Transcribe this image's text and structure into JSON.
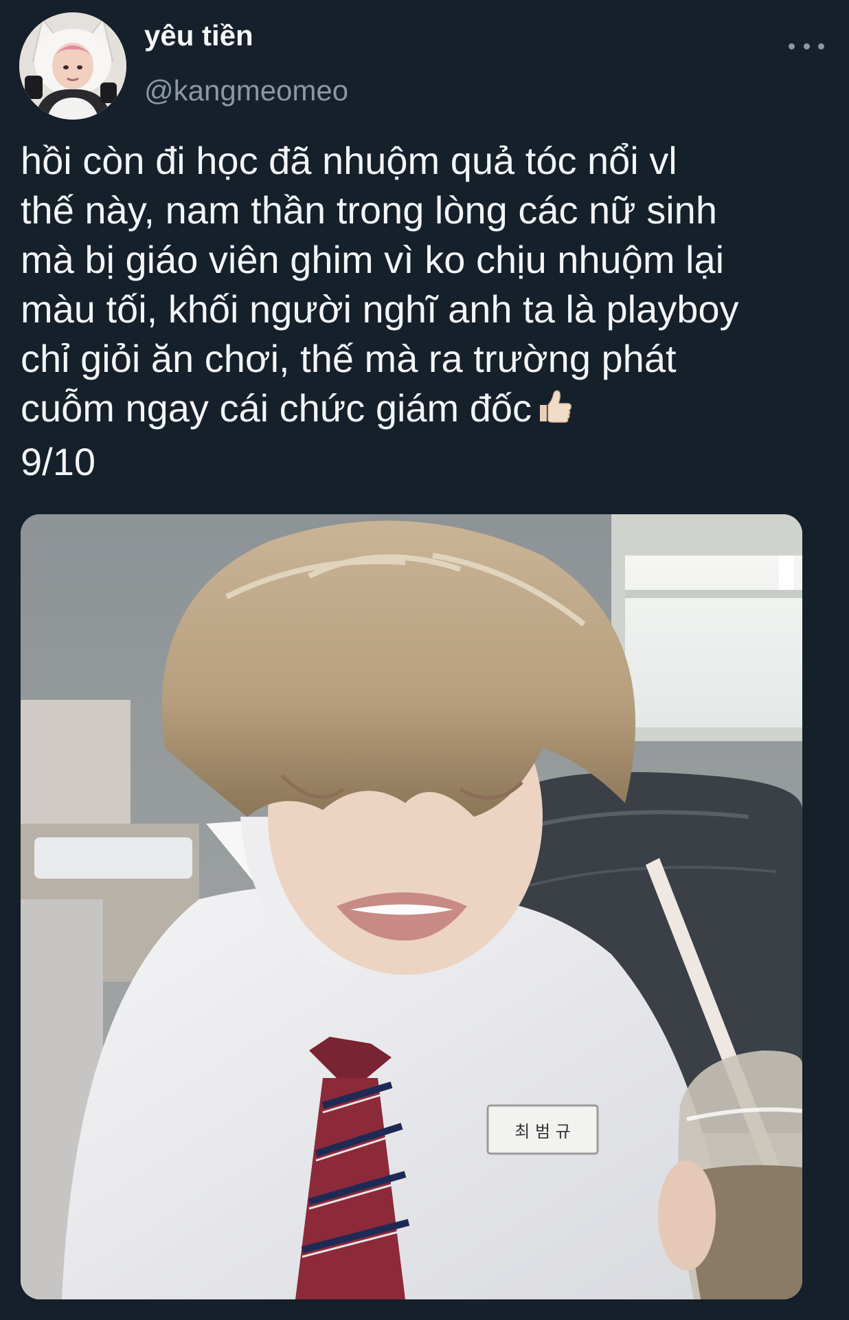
{
  "tweet": {
    "author": {
      "display_name": "yêu tiền",
      "handle": "@kangmeomeo",
      "avatar_icon": "avatar-photo"
    },
    "more_icon": "more-horizontal-icon",
    "text_lines": [
      "hồi còn đi học đã nhuộm quả tóc nổi vl",
      "thế này, nam thần trong lòng các nữ sinh",
      "mà bị giáo viên ghim vì ko chịu nhuộm lại",
      "màu tối, khối người nghĩ anh ta là playboy",
      "chỉ giỏi ăn chơi, thế mà ra trường phát",
      "cuỗm ngay cái chức giám đốc"
    ],
    "emoji": "thumbs-up-icon",
    "rating": "9/10",
    "photo": {
      "name_tag": "최 범 규"
    }
  },
  "colors": {
    "background": "#16202b",
    "text": "#f3f5f7",
    "secondary_text": "#8a98a6"
  }
}
